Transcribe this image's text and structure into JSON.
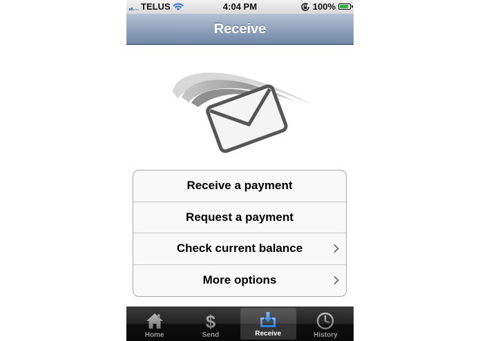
{
  "status_bar": {
    "carrier": "TELUS",
    "time": "4:04 PM",
    "battery": "100%",
    "battery_level": 1.0
  },
  "nav": {
    "title": "Receive"
  },
  "menu": {
    "items": [
      {
        "label": "Receive a payment",
        "has_chevron": false
      },
      {
        "label": "Request a payment",
        "has_chevron": false
      },
      {
        "label": "Check current balance",
        "has_chevron": true
      },
      {
        "label": "More options",
        "has_chevron": true
      }
    ]
  },
  "tabs": [
    {
      "label": "Home",
      "icon": "home-icon",
      "active": false
    },
    {
      "label": "Send",
      "icon": "dollar-icon",
      "active": false
    },
    {
      "label": "Receive",
      "icon": "download-tray-icon",
      "active": true
    },
    {
      "label": "History",
      "icon": "clock-icon",
      "active": false
    }
  ],
  "colors": {
    "nav_top": "#b4c2d4",
    "nav_bottom": "#6f87a6",
    "active_tab_icon": "#3f8ee8",
    "battery_green": "#34b33b"
  }
}
